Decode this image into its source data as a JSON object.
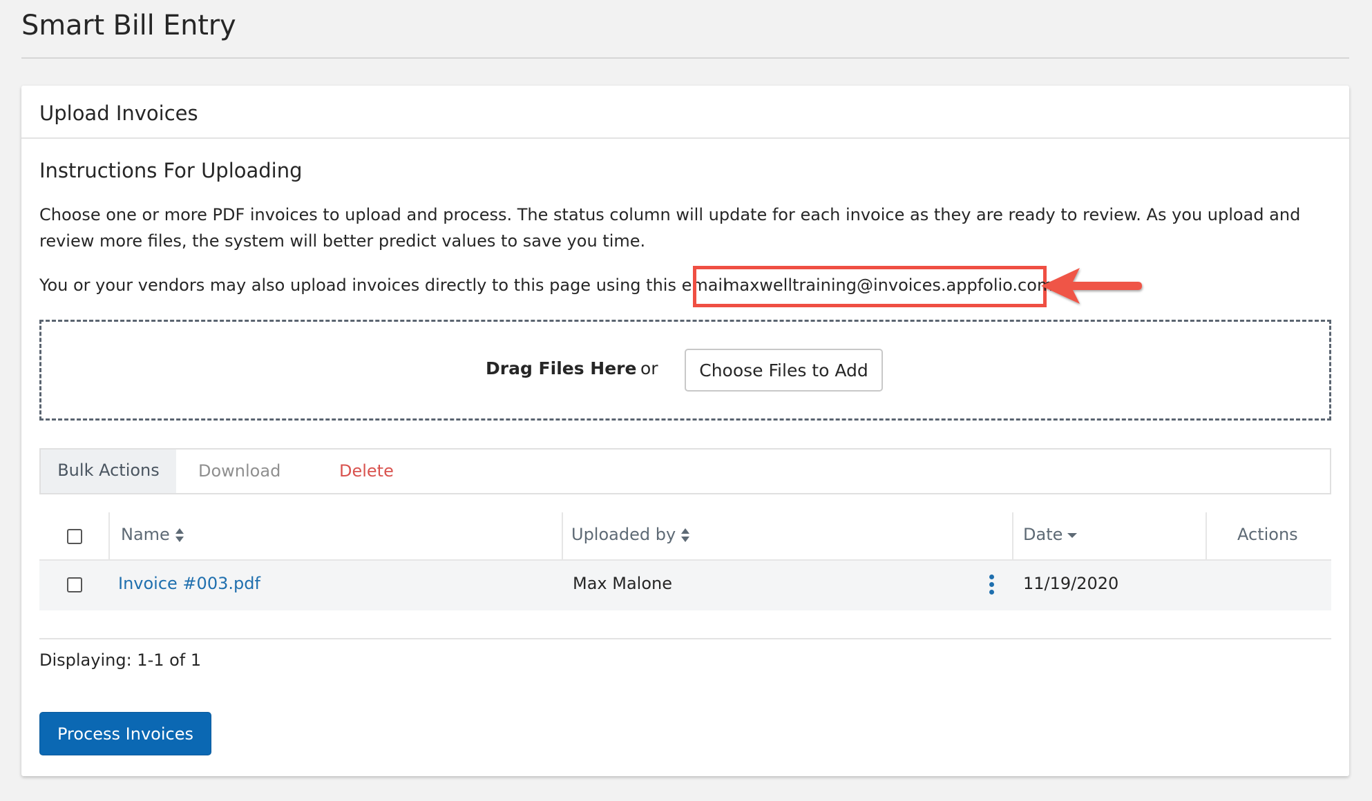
{
  "page": {
    "title": "Smart Bill Entry"
  },
  "panel": {
    "title": "Upload Invoices",
    "section_title": "Instructions For Uploading",
    "instructions": "Choose one or more PDF invoices to upload and process. The status column will update for each invoice as they are ready to review. As you upload and review more files, the system will better predict values to save you time.",
    "email_text": "You or your vendors may also upload invoices directly to this page using this email",
    "email": "maxwelltraining@invoices.appfolio.com",
    "highlight_color": "#ef4f43"
  },
  "dropzone": {
    "drag_label": "Drag Files Here",
    "or_label": "or",
    "choose_label": "Choose Files to Add"
  },
  "bulk": {
    "label": "Bulk Actions",
    "download": "Download",
    "delete": "Delete"
  },
  "table": {
    "columns": {
      "name": "Name",
      "uploaded_by": "Uploaded by",
      "date": "Date",
      "actions": "Actions"
    },
    "rows": [
      {
        "name": "Invoice #003.pdf",
        "uploaded_by": "Max Malone",
        "date": "11/19/2020"
      }
    ]
  },
  "footer": {
    "displaying": "Displaying: 1-1 of 1",
    "process_label": "Process Invoices"
  },
  "colors": {
    "primary": "#0b68b3",
    "link": "#1f6fae",
    "danger": "#d9534f"
  }
}
